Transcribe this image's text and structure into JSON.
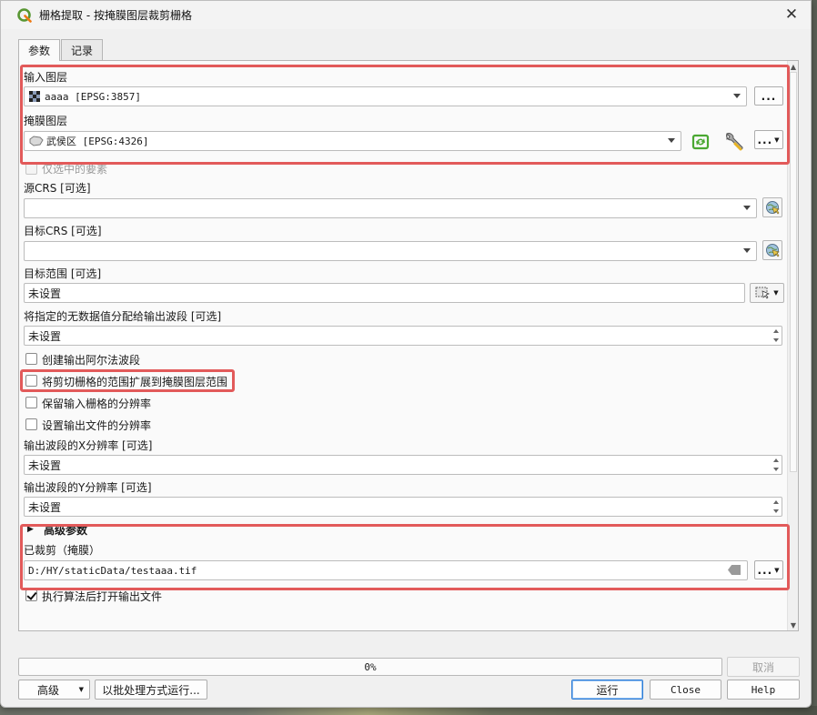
{
  "window": {
    "title": "栅格提取 - 按掩膜图层裁剪栅格"
  },
  "tabs": [
    {
      "label": "参数"
    },
    {
      "label": "记录"
    }
  ],
  "params": {
    "input_layer_label": "输入图层",
    "input_layer_value": "aaaa [EPSG:3857]",
    "mask_layer_label": "掩膜图层",
    "mask_layer_value": "武侯区 [EPSG:4326]",
    "selected_only_label": "仅选中的要素",
    "src_crs_label": "源CRS [可选]",
    "src_crs_value": "",
    "target_crs_label": "目标CRS [可选]",
    "target_crs_value": "",
    "target_extent_label": "目标范围 [可选]",
    "target_extent_value": "未设置",
    "nodata_label": "将指定的无数据值分配给输出波段 [可选]",
    "nodata_value": "未设置",
    "alpha_label": "创建输出阿尔法波段",
    "crop_extent_label": "将剪切栅格的范围扩展到掩膜图层范围",
    "keep_res_label": "保留输入栅格的分辨率",
    "set_res_label": "设置输出文件的分辨率",
    "x_res_label": "输出波段的X分辨率 [可选]",
    "x_res_value": "未设置",
    "y_res_label": "输出波段的Y分辨率 [可选]",
    "y_res_value": "未设置",
    "advanced_label": "高级参数",
    "output_label": "已裁剪（掩膜）",
    "output_value": "D:/HY/staticData/testaaa.tif",
    "open_after_label": "执行算法后打开输出文件",
    "open_after_checked": true,
    "dots": "..."
  },
  "footer": {
    "progress_text": "0%",
    "progress": 0,
    "cancel_label": "取消",
    "advanced_btn": "高级",
    "batch_btn": "以批处理方式运行...",
    "run_btn": "运行",
    "close_btn": "Close",
    "help_btn": "Help"
  },
  "colors": {
    "highlight": "#e25a5a",
    "qgis_green": "#589632"
  }
}
